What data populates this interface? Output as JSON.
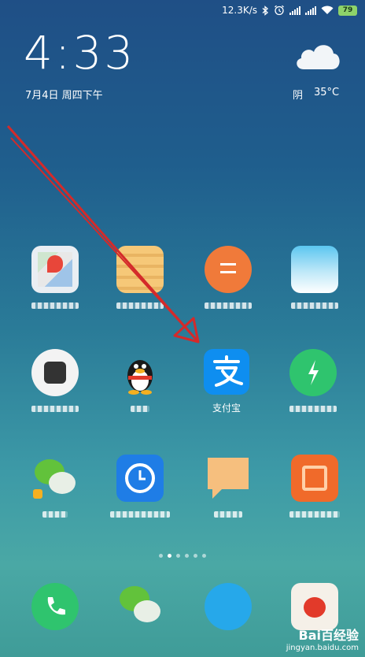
{
  "status_bar": {
    "speed": "12.3K/s",
    "battery": "79",
    "icons": [
      "bluetooth-icon",
      "alarm-icon",
      "signal-icon",
      "signal-icon",
      "wifi-icon",
      "battery-icon"
    ]
  },
  "lockclock": {
    "time": "4:33",
    "date": "7月4日 周四下午"
  },
  "weather": {
    "condition": "阴",
    "temperature": "35°C",
    "icon": "cloud-icon"
  },
  "apps": {
    "alipay_label": "支付宝"
  },
  "watermark": {
    "brand": "Bai百经验",
    "url": "jingyan.baidu.com"
  },
  "colors": {
    "alipay_blue": "#0e8ef0",
    "arrow_red": "#d42a2a",
    "battery_green": "#8ed36a"
  }
}
